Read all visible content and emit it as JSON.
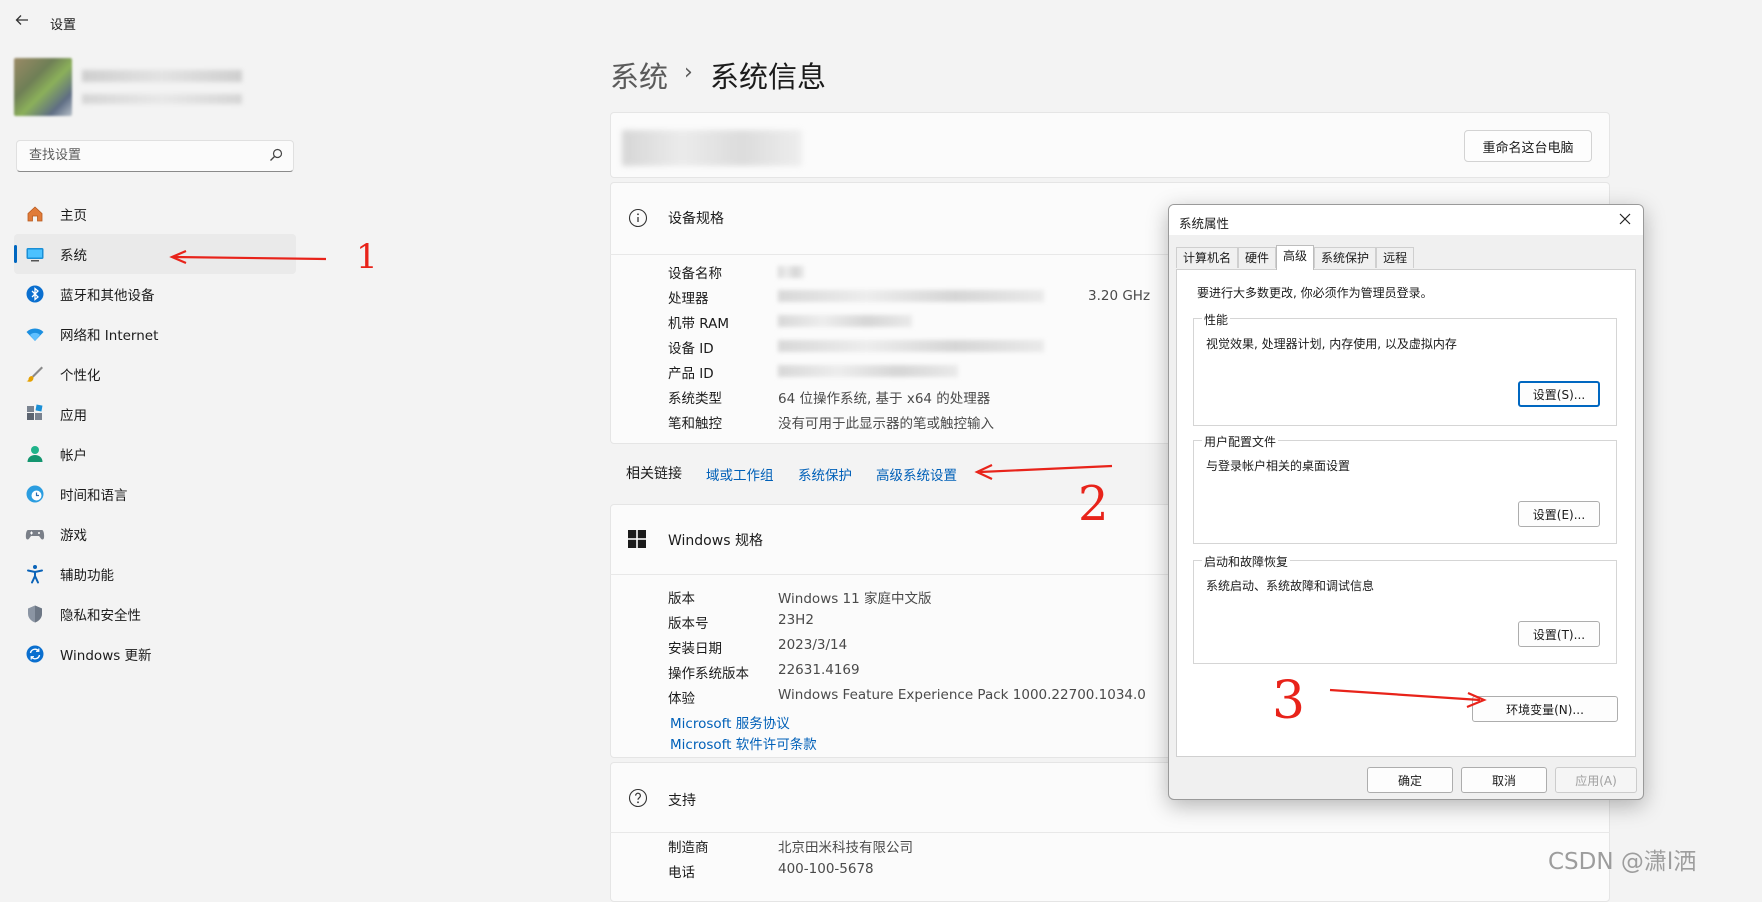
{
  "window": {
    "title": "设置"
  },
  "search": {
    "placeholder": "查找设置"
  },
  "sidebar": {
    "items": [
      {
        "label": "主页",
        "icon": "home-icon"
      },
      {
        "label": "系统",
        "icon": "monitor-icon",
        "active": true
      },
      {
        "label": "蓝牙和其他设备",
        "icon": "bluetooth-icon"
      },
      {
        "label": "网络和 Internet",
        "icon": "wifi-icon"
      },
      {
        "label": "个性化",
        "icon": "brush-icon"
      },
      {
        "label": "应用",
        "icon": "apps-icon"
      },
      {
        "label": "帐户",
        "icon": "person-icon"
      },
      {
        "label": "时间和语言",
        "icon": "globe-clock-icon"
      },
      {
        "label": "游戏",
        "icon": "gamepad-icon"
      },
      {
        "label": "辅助功能",
        "icon": "accessibility-icon"
      },
      {
        "label": "隐私和安全性",
        "icon": "shield-icon"
      },
      {
        "label": "Windows 更新",
        "icon": "update-icon"
      }
    ]
  },
  "breadcrumb": {
    "parent": "系统",
    "separator": "›",
    "current": "系统信息"
  },
  "device": {
    "rename_button": "重命名这台电脑"
  },
  "device_specs": {
    "title": "设备规格",
    "rows": [
      {
        "label": "设备名称",
        "value": ""
      },
      {
        "label": "处理器",
        "value": ""
      },
      {
        "label": "机带 RAM",
        "value": ""
      },
      {
        "label": "设备 ID",
        "value": ""
      },
      {
        "label": "产品 ID",
        "value": ""
      },
      {
        "label": "系统类型",
        "value": "64 位操作系统, 基于 x64 的处理器"
      },
      {
        "label": "笔和触控",
        "value": "没有可用于此显示器的笔或触控输入"
      }
    ],
    "cpu_speed": "3.20 GHz"
  },
  "related_links": {
    "label": "相关链接",
    "links": [
      "域或工作组",
      "系统保护",
      "高级系统设置"
    ]
  },
  "windows_specs": {
    "title": "Windows 规格",
    "rows": [
      {
        "label": "版本",
        "value": "Windows 11 家庭中文版"
      },
      {
        "label": "版本号",
        "value": "23H2"
      },
      {
        "label": "安装日期",
        "value": "2023/3/14"
      },
      {
        "label": "操作系统版本",
        "value": "22631.4169"
      },
      {
        "label": "体验",
        "value": "Windows Feature Experience Pack 1000.22700.1034.0"
      }
    ],
    "links": [
      "Microsoft 服务协议",
      "Microsoft 软件许可条款"
    ]
  },
  "support": {
    "title": "支持",
    "rows": [
      {
        "label": "制造商",
        "value": "北京田米科技有限公司"
      },
      {
        "label": "电话",
        "value": "400-100-5678"
      }
    ]
  },
  "dialog": {
    "title": "系统属性",
    "tabs": [
      "计算机名",
      "硬件",
      "高级",
      "系统保护",
      "远程"
    ],
    "active_tab": "高级",
    "admin_note": "要进行大多数更改, 你必须作为管理员登录。",
    "groups": [
      {
        "label": "性能",
        "desc": "视觉效果, 处理器计划, 内存使用, 以及虚拟内存",
        "button": "设置(S)..."
      },
      {
        "label": "用户配置文件",
        "desc": "与登录帐户相关的桌面设置",
        "button": "设置(E)..."
      },
      {
        "label": "启动和故障恢复",
        "desc": "系统启动、系统故障和调试信息",
        "button": "设置(T)..."
      }
    ],
    "env_button": "环境变量(N)...",
    "ok": "确定",
    "cancel": "取消",
    "apply": "应用(A)"
  },
  "annotations": [
    "1",
    "2",
    "3"
  ],
  "watermark": "CSDN @潇l洒",
  "colors": {
    "accent": "#0067c0",
    "link": "#0060b8",
    "annotation": "#e8231a"
  }
}
